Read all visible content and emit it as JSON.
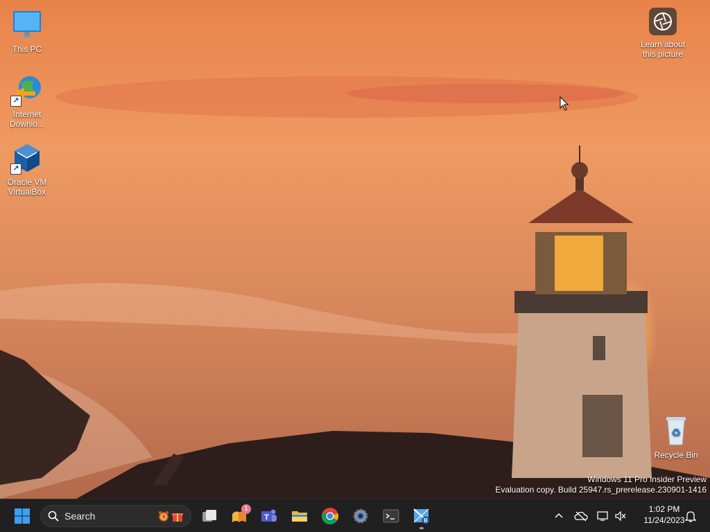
{
  "desktop": {
    "icons": [
      {
        "label": "This PC"
      },
      {
        "label": "Internet Downlo..."
      },
      {
        "label": "Oracle VM VirtualBox"
      },
      {
        "label": "Recycle Bin"
      }
    ],
    "learn_picture": {
      "line1": "Learn about",
      "line2": "this picture"
    },
    "watermark": {
      "line1": "Windows 11 Pro Insider Preview",
      "line2": "Evaluation copy. Build 25947.rs_prerelease.230901-1416"
    }
  },
  "taskbar": {
    "search_label": "Search",
    "widgets_badge": "1",
    "clock_time": "1:02 PM",
    "clock_date": "11/24/2023",
    "icons": [
      "windows-start-icon",
      "search-icon",
      "task-view-icon",
      "widgets-icon",
      "teams-icon",
      "file-explorer-icon",
      "chrome-icon",
      "settings-icon",
      "terminal-icon",
      "bginfo-icon"
    ]
  },
  "colors": {
    "taskbar_bg": "#202020",
    "accent": "#0078d4"
  }
}
